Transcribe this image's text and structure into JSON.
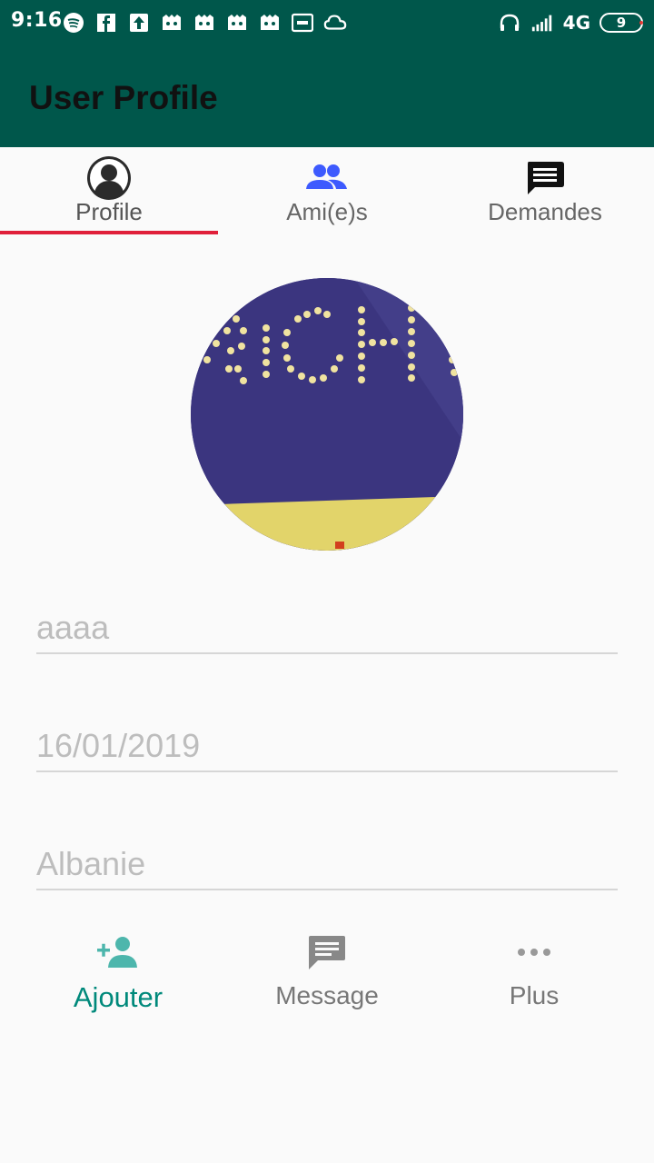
{
  "status_bar": {
    "time": "9:16",
    "network": "4G",
    "battery": "9",
    "icons": [
      "spotify-icon",
      "facebook-icon",
      "upload-icon",
      "game-icon",
      "game-icon",
      "game-icon",
      "game-icon",
      "voicemail-icon",
      "cloud-icon",
      "headphones-icon",
      "signal-icon"
    ]
  },
  "toolbar": {
    "title": "User Profile"
  },
  "tabs": [
    {
      "label": "Profile",
      "icon": "profile-icon",
      "active": true
    },
    {
      "label": "Ami(e)s",
      "icon": "friends-icon",
      "active": false
    },
    {
      "label": "Demandes",
      "icon": "chat-icon",
      "active": false
    }
  ],
  "colors": {
    "primary_dark": "#00574b",
    "accent": "#e0203a",
    "teal": "#00897b",
    "friends_blue": "#3d5afe"
  },
  "profile": {
    "name": "aaaa",
    "birthdate": "16/01/2019",
    "country": "Albanie"
  },
  "actions": [
    {
      "label": "Ajouter",
      "icon": "add-person-icon",
      "active": true
    },
    {
      "label": "Message",
      "icon": "message-icon",
      "active": false
    },
    {
      "label": "Plus",
      "icon": "more-icon",
      "active": false
    }
  ]
}
